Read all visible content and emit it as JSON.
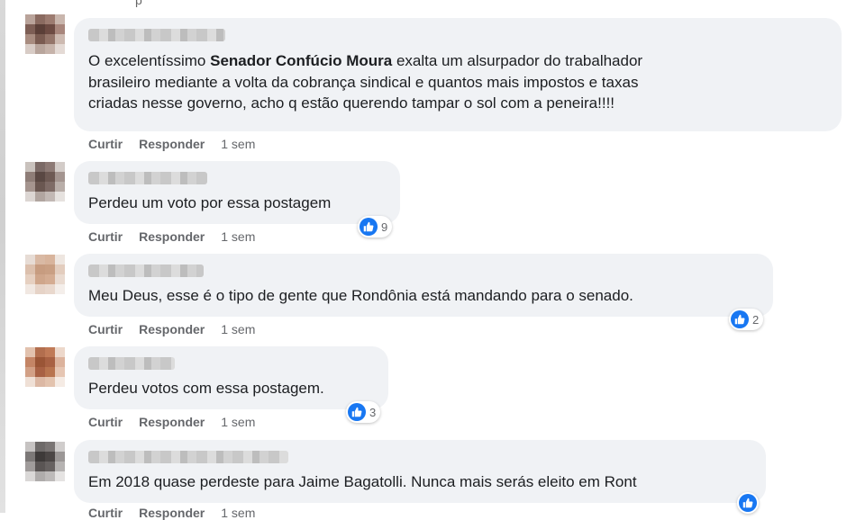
{
  "colors": {
    "bubble": "#f0f2f5",
    "like": "#1877f2",
    "meta": "#65676b"
  },
  "top_fragment": "p",
  "actions": {
    "like": "Curtir",
    "reply": "Responder"
  },
  "comments": [
    {
      "text_prefix": "O excelentíssimo ",
      "highlight": "Senador Confúcio Moura",
      "text_suffix": " exalta um alsurpador do trabalhador",
      "line2": "brasileiro mediante a volta da cobrança sindical e quantos mais impostos e taxas",
      "line3": "criadas nesse governo, acho q estão querendo tampar o sol com a peneira!!!!",
      "time": "1 sem",
      "reactions": ""
    },
    {
      "text": "Perdeu um voto por essa postagem",
      "time": "1 sem",
      "reactions": "9"
    },
    {
      "text": "Meu Deus, esse é o tipo de gente que Rondônia está mandando para o senado.",
      "time": "1 sem",
      "reactions": "2"
    },
    {
      "text": "Perdeu votos com essa postagem.",
      "time": "1 sem",
      "reactions": "3"
    },
    {
      "text": "Em 2018 quase perdeste para Jaime Bagatolli. Nunca mais serás eleito em Ront",
      "time": "1 sem",
      "reactions": ""
    }
  ]
}
